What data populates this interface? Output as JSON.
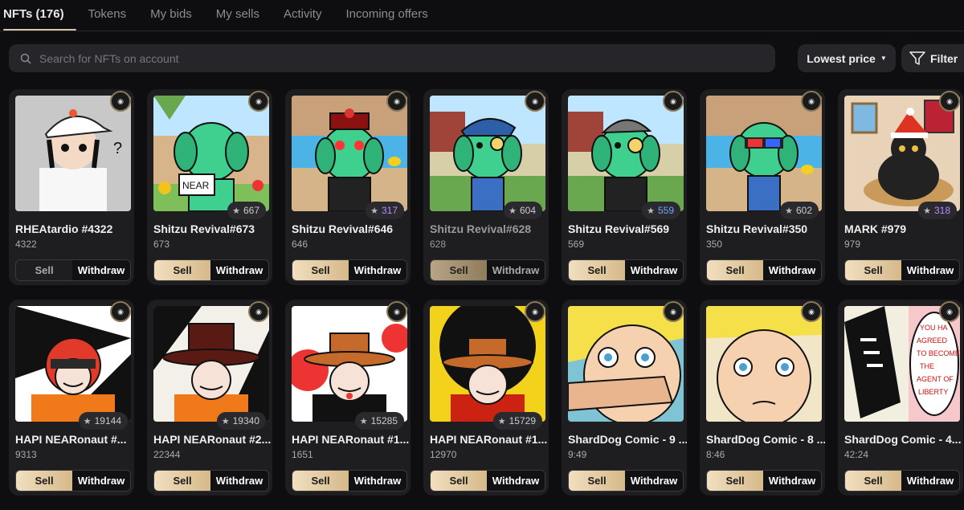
{
  "tabs": [
    {
      "label": "NFTs (176)",
      "active": true
    },
    {
      "label": "Tokens"
    },
    {
      "label": "My bids"
    },
    {
      "label": "My sells"
    },
    {
      "label": "Activity"
    },
    {
      "label": "Incoming offers"
    }
  ],
  "search": {
    "placeholder": "Search for NFTs on account"
  },
  "sort": {
    "label": "Lowest price"
  },
  "filter": {
    "label": "Filter"
  },
  "actions": {
    "sell": "Sell",
    "withdraw": "Withdraw"
  },
  "cards": [
    {
      "title": "RHEAtardio #4322",
      "sub": "4322",
      "rank": "",
      "art": "rhea"
    },
    {
      "title": "Shitzu Revival#673",
      "sub": "673",
      "rank": "667",
      "art": "shitzu1"
    },
    {
      "title": "Shitzu Revival#646",
      "sub": "646",
      "rank": "317",
      "rank_color": "purple",
      "art": "shitzu2"
    },
    {
      "title": "Shitzu Revival#628",
      "sub": "628",
      "rank": "604",
      "art": "shitzu3",
      "dim": true
    },
    {
      "title": "Shitzu Revival#569",
      "sub": "569",
      "rank": "559",
      "rank_color": "blue",
      "art": "shitzu4"
    },
    {
      "title": "Shitzu Revival#350",
      "sub": "350",
      "rank": "602",
      "art": "shitzu5"
    },
    {
      "title": "MARK #979",
      "sub": "979",
      "rank": "318",
      "rank_color": "purple",
      "art": "mark"
    },
    {
      "title": "HAPI NEARonaut #...",
      "sub": "9313",
      "rank": "19144",
      "art": "hapi1"
    },
    {
      "title": "HAPI NEARonaut #2...",
      "sub": "22344",
      "rank": "19340",
      "art": "hapi2"
    },
    {
      "title": "HAPI NEARonaut #1...",
      "sub": "1651",
      "rank": "15285",
      "art": "hapi3"
    },
    {
      "title": "HAPI NEARonaut #1...",
      "sub": "12970",
      "rank": "15729",
      "art": "hapi4"
    },
    {
      "title": "ShardDog Comic - 9 ...",
      "sub": "9:49",
      "rank": "",
      "art": "comic1"
    },
    {
      "title": "ShardDog Comic - 8 ...",
      "sub": "8:46",
      "rank": "",
      "art": "comic2"
    },
    {
      "title": "ShardDog Comic - 4...",
      "sub": "42:24",
      "rank": "",
      "art": "comic3"
    }
  ],
  "colors": {
    "accent": "#d9c6a6",
    "background": "#0e0e10",
    "card": "#1e1e21"
  },
  "icons": {
    "search": "search-icon",
    "filter": "filter-icon",
    "sort": "chevron-down-icon",
    "collection": "collection-badge-icon",
    "rank": "star-icon"
  }
}
